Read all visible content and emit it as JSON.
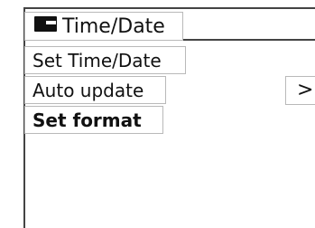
{
  "header": {
    "icon": "display-icon",
    "title": "Time/Date"
  },
  "menu": {
    "items": [
      {
        "label": "Set Time/Date",
        "selected": false
      },
      {
        "label": "Auto update",
        "selected": false
      },
      {
        "label": "Set format",
        "selected": true
      }
    ]
  },
  "navigation": {
    "arrow_label": ">"
  }
}
